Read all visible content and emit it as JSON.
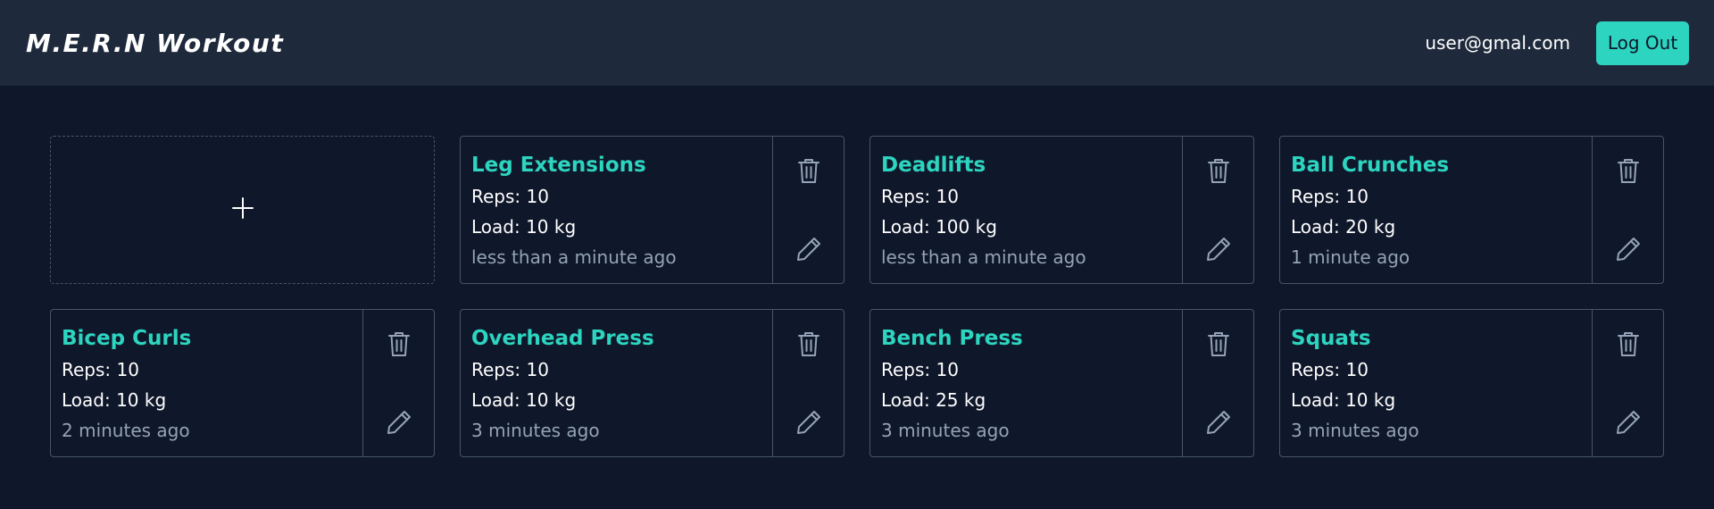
{
  "header": {
    "brand": "M.E.R.N Workout",
    "user_email": "user@gmal.com",
    "logout_label": "Log Out"
  },
  "add_card": {
    "icon": "plus-icon"
  },
  "labels": {
    "reps_prefix": "Reps: ",
    "load_prefix": "Load: ",
    "load_unit": " kg"
  },
  "workouts": [
    {
      "title": "Leg Extensions",
      "reps": "Reps: 10",
      "load": "Load: 10 kg",
      "time": "less than a minute ago"
    },
    {
      "title": "Deadlifts",
      "reps": "Reps: 10",
      "load": "Load: 100 kg",
      "time": "less than a minute ago"
    },
    {
      "title": "Ball Crunches",
      "reps": "Reps: 10",
      "load": "Load: 20 kg",
      "time": "1 minute ago"
    },
    {
      "title": "Bicep Curls",
      "reps": "Reps: 10",
      "load": "Load: 10 kg",
      "time": "2 minutes ago"
    },
    {
      "title": "Overhead Press",
      "reps": "Reps: 10",
      "load": "Load: 10 kg",
      "time": "3 minutes ago"
    },
    {
      "title": "Bench Press",
      "reps": "Reps: 10",
      "load": "Load: 25 kg",
      "time": "3 minutes ago"
    },
    {
      "title": "Squats",
      "reps": "Reps: 10",
      "load": "Load: 10 kg",
      "time": "3 minutes ago"
    }
  ],
  "icons": {
    "delete": "trash-icon",
    "edit": "pencil-icon"
  },
  "colors": {
    "background": "#0f172a",
    "navbar": "#1e293b",
    "accent": "#2dd4bf",
    "border": "#475569",
    "muted_text": "#94a3b8"
  }
}
